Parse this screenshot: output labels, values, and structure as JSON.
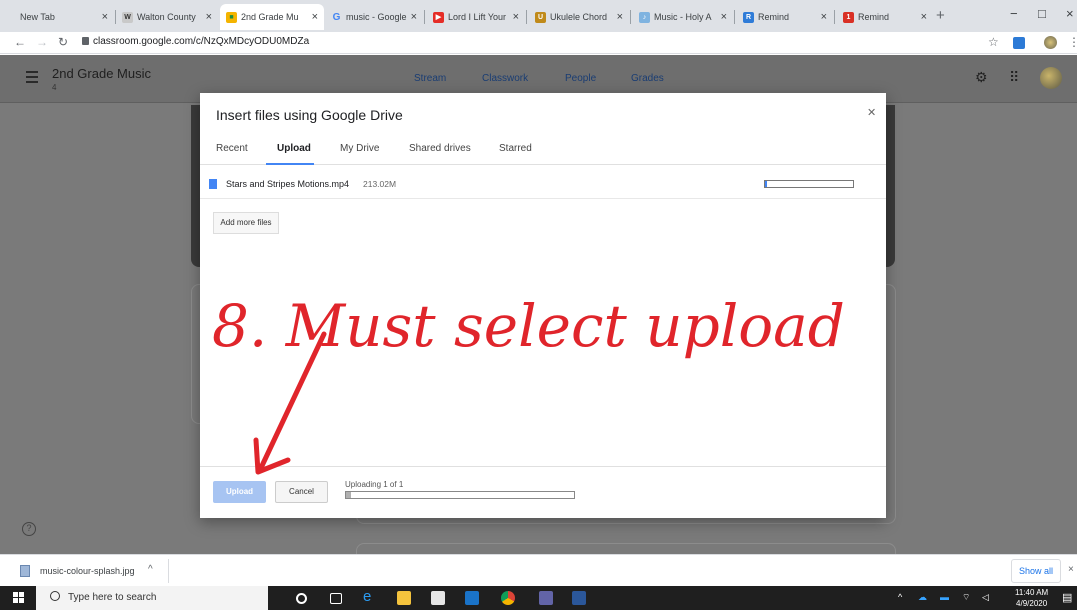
{
  "browser": {
    "tabs": [
      {
        "title": "New Tab",
        "active": false
      },
      {
        "title": "Walton County",
        "active": false
      },
      {
        "title": "2nd Grade Mu",
        "active": true
      },
      {
        "title": "music - Google",
        "active": false
      },
      {
        "title": "Lord I Lift Your",
        "active": false
      },
      {
        "title": "Ukulele Chord",
        "active": false
      },
      {
        "title": "Music - Holy A",
        "active": false
      },
      {
        "title": "Remind",
        "active": false
      },
      {
        "title": "Remind",
        "active": false
      }
    ],
    "url": "classroom.google.com/c/NzQxMDcyODU0MDZa"
  },
  "classroom": {
    "class_name": "2nd Grade Music",
    "class_section": "4",
    "nav": [
      "Stream",
      "Classwork",
      "People",
      "Grades"
    ]
  },
  "dialog": {
    "title": "Insert files using Google Drive",
    "tabs": [
      "Recent",
      "Upload",
      "My Drive",
      "Shared drives",
      "Starred"
    ],
    "file": {
      "name": "Stars and Stripes Motions.mp4",
      "size": "213.02M",
      "progress": 0.02
    },
    "add_more": "Add more files",
    "upload_button": "Upload",
    "cancel_button": "Cancel",
    "status": "Uploading 1 of 1",
    "overall_progress": 0.02
  },
  "annotation": {
    "text": "8. Must select upload",
    "color": "#e0252b"
  },
  "downloads": {
    "file_name": "music-colour-splash.jpg",
    "show_all": "Show all"
  },
  "taskbar": {
    "search_placeholder": "Type here to search",
    "time": "11:40 AM",
    "date": "4/9/2020"
  }
}
